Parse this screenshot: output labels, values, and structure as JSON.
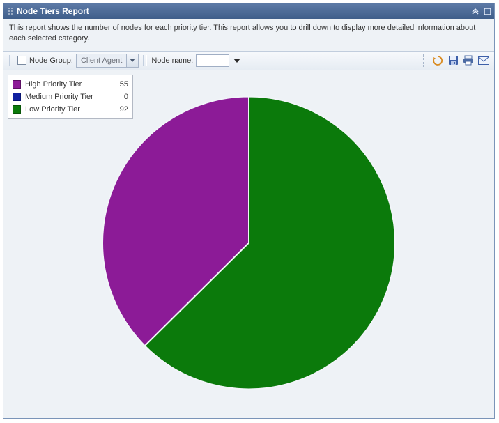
{
  "header": {
    "title": "Node Tiers Report"
  },
  "description": "This report shows the number of nodes for each priority tier. This report allows you to drill down to display more detailed information about each selected category.",
  "toolbar": {
    "node_group_label": "Node Group:",
    "node_group_value": "Client Agent",
    "node_name_label": "Node name:",
    "node_name_value": ""
  },
  "colors": {
    "high": "#8c1b97",
    "medium": "#1020a0",
    "low": "#0b7a0b"
  },
  "chart_data": {
    "type": "pie",
    "title": "",
    "series": [
      {
        "name": "High Priority Tier",
        "value": 55,
        "color": "#8c1b97"
      },
      {
        "name": "Medium Priority Tier",
        "value": 0,
        "color": "#1020a0"
      },
      {
        "name": "Low Priority Tier",
        "value": 92,
        "color": "#0b7a0b"
      }
    ]
  }
}
